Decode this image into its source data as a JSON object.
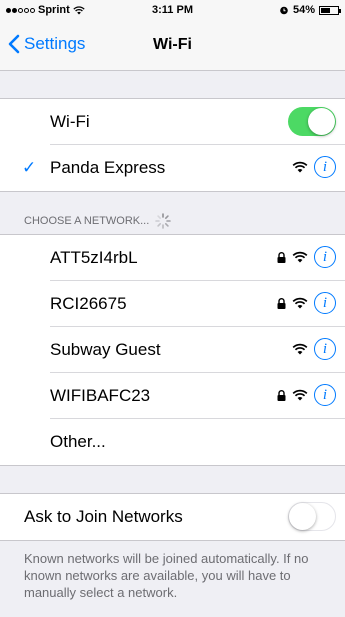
{
  "status_bar": {
    "carrier": "Sprint",
    "time": "3:11 PM",
    "battery": "54%",
    "battery_level": 0.54
  },
  "nav": {
    "back_label": "Settings",
    "title": "Wi-Fi"
  },
  "wifi_toggle": {
    "label": "Wi-Fi",
    "on": true
  },
  "connected": {
    "name": "Panda Express",
    "locked": false
  },
  "networks_header": "CHOOSE A NETWORK...",
  "networks": [
    {
      "name": "ATT5zI4rbL",
      "locked": true
    },
    {
      "name": "RCI26675",
      "locked": true
    },
    {
      "name": "Subway Guest",
      "locked": false
    },
    {
      "name": "WIFIBAFC23",
      "locked": true
    }
  ],
  "other_label": "Other...",
  "ask_to_join": {
    "label": "Ask to Join Networks",
    "on": false
  },
  "footer": "Known networks will be joined automatically. If no known networks are available, you will have to manually select a network.",
  "colors": {
    "accent": "#007aff",
    "toggle_on": "#4cd964",
    "background": "#efeff4"
  }
}
